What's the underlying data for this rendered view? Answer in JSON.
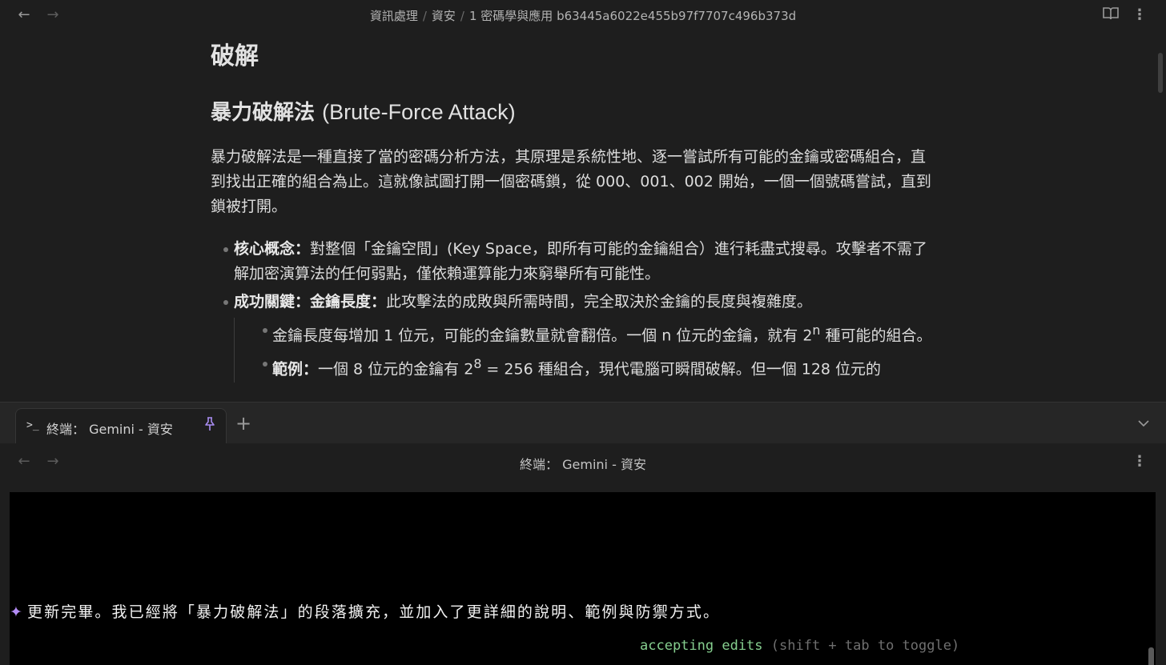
{
  "editor": {
    "breadcrumb": [
      "資訊處理",
      "資安",
      "1 密碼學與應用 b63445a6022e455b97f7707c496b373d"
    ],
    "heading_1": "破解",
    "heading_2_zh": "暴力破解法",
    "heading_2_en": "(Brute-Force Attack)",
    "intro": "暴力破解法是一種直接了當的密碼分析方法，其原理是系統性地、逐一嘗試所有可能的金鑰或密碼組合，直到找出正確的組合為止。這就像試圖打開一個密碼鎖，從 000、001、002 開始，一個一個號碼嘗試，直到鎖被打開。",
    "bullets": [
      {
        "label": "核心概念：",
        "text": "對整個「金鑰空間」(Key Space，即所有可能的金鑰組合）進行耗盡式搜尋。攻擊者不需了解加密演算法的任何弱點，僅依賴運算能力來窮舉所有可能性。"
      },
      {
        "label": "成功關鍵：金鑰長度：",
        "text": "此攻擊法的成敗與所需時間，完全取決於金鑰的長度與複雜度。"
      }
    ],
    "sub_bullets": [
      {
        "label": "",
        "text_before": "金鑰長度每增加 1 位元，可能的金鑰數量就會翻倍。一個 n 位元的金鑰，就有 2",
        "sup": "n",
        "text_after": " 種可能的組合。"
      },
      {
        "label": "範例：",
        "text_before": "一個 8 位元的金鑰有 2",
        "sup": "8",
        "text_after": " = 256 種組合，現代電腦可瞬間破解。但一個 128 位元的"
      }
    ]
  },
  "tabs": {
    "active_tab": {
      "icon": "terminal-icon",
      "title": "終端： Gemini - 資安",
      "pinned": true
    }
  },
  "terminal": {
    "title": "終端： Gemini - 資安",
    "message": "更新完畢。我已經將「暴力破解法」的段落擴充，並加入了更詳細的說明、範例與防禦方式。",
    "status": "accepting edits",
    "status_hint": "(shift + tab to toggle)"
  },
  "colors": {
    "accent": "#a88cf0",
    "status_green": "#86cf8f",
    "background": "#1e1e1e",
    "terminal_bg": "#000000"
  }
}
